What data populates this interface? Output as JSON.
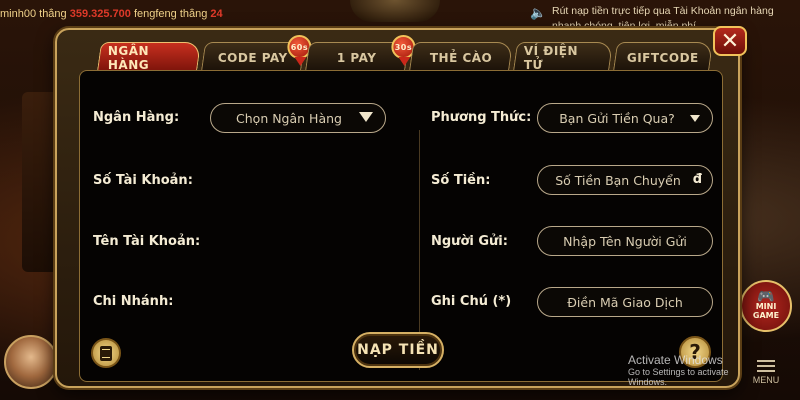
{
  "ticker_left": {
    "user1": "minh00",
    "verb1": " thắng ",
    "amount1": "359.325.700",
    "user2": "fengfeng",
    "verb2": " thắng ",
    "amount2": "24"
  },
  "ticker_right": "Rút nạp tiền trực tiếp qua Tài Khoản ngân hàng nhanh chóng, tiện lợi, miễn phí",
  "tabs": [
    {
      "label": "NGÂN HÀNG",
      "active": true
    },
    {
      "label": "CODE PAY",
      "badge": "60s"
    },
    {
      "label": "1 PAY",
      "badge": "30s"
    },
    {
      "label": "THẺ CÀO"
    },
    {
      "label": "VÍ ĐIỆN TỬ"
    },
    {
      "label": "GIFTCODE"
    }
  ],
  "close_label": "✕",
  "left_fields": {
    "bank_label": "Ngân Hàng:",
    "bank_select": "Chọn Ngân Hàng",
    "account_number_label": "Số Tài Khoản:",
    "account_name_label": "Tên Tài Khoản:",
    "branch_label": "Chi Nhánh:"
  },
  "right_fields": {
    "method_label": "Phương Thức:",
    "method_select": "Bạn Gửi Tiền Qua?",
    "amount_label": "Số Tiền:",
    "amount_placeholder": "Số Tiền Bạn Chuyển",
    "amount_currency": "đ",
    "sender_label": "Người Gửi:",
    "sender_placeholder": "Nhập Tên Người Gửi",
    "note_label": "Ghi Chú (*)",
    "note_placeholder": "Điền Mã Giao Dịch"
  },
  "submit_label": "NẠP TIỀN",
  "help_label": "?",
  "minigame": {
    "line1": "MINI",
    "line2": "GAME"
  },
  "menu_label": "MENU",
  "watermark": {
    "title": "Activate Windows",
    "subtitle": "Go to Settings to activate Windows."
  },
  "colors": {
    "active_tab": "#c7301f",
    "gold_border": "#c9a35c",
    "panel_bg": "#050302",
    "ticker_amount": "#e03a2a"
  },
  "icons": [
    "speaker-icon",
    "close-icon",
    "chevron-down-icon",
    "notes-icon",
    "help-icon",
    "gamepad-icon",
    "menu-icon"
  ]
}
